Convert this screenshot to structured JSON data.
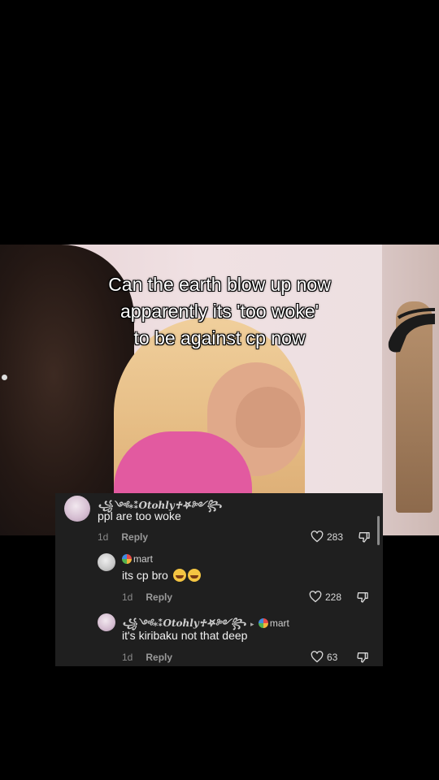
{
  "caption": {
    "line1": "Can the earth blow up now",
    "line2": "apparently its 'too woke'",
    "line3": "to be against cp now"
  },
  "comments": [
    {
      "username": "꧁༺⁎⁑𝑶𝒕𝒐𝒉𝒍𝒚♱𖤐༻꧂",
      "text": "ppl are too woke",
      "time": "1d",
      "reply_label": "Reply",
      "likes": "283"
    },
    {
      "username": "mart",
      "text": "its cp bro",
      "time": "1d",
      "reply_label": "Reply",
      "likes": "228"
    },
    {
      "username": "꧁༺⁎⁑𝑶𝒕𝒐𝒉𝒍𝒚♱𖤐༻꧂",
      "reply_to": "mart",
      "text": "it's kiribaku not that deep",
      "time": "1d",
      "reply_label": "Reply",
      "likes": "63"
    }
  ],
  "icons": {
    "like": "heart-outline-icon",
    "dislike": "thumbs-down-outline-icon",
    "emoji": "loudly-crying-face-emoji"
  },
  "colors": {
    "background": "#000000",
    "comment_panel": "#1f1f1f",
    "caption_text": "#ffffff"
  }
}
